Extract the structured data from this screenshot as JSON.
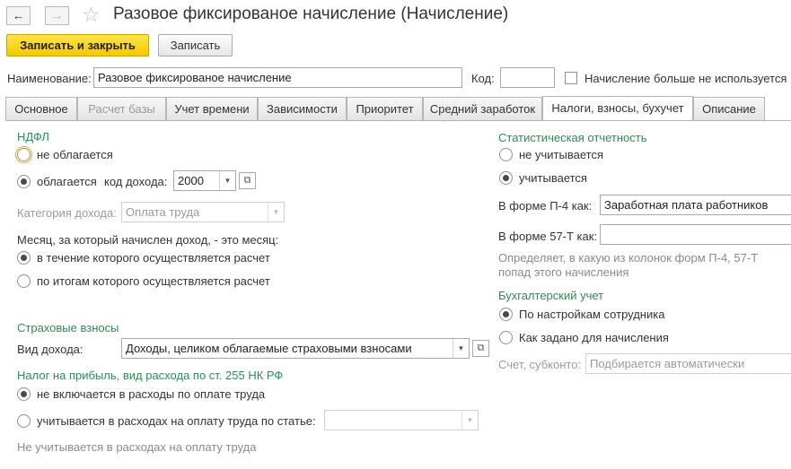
{
  "window": {
    "title": "Разовое фиксированое начисление (Начисление)"
  },
  "toolbar": {
    "save_close_label": "Записать и закрыть",
    "save_label": "Записать"
  },
  "header": {
    "name_label": "Наименование:",
    "name_value": "Разовое фиксированое начисление",
    "code_label": "Код:",
    "code_value": "",
    "unused_label": "Начисление больше не используется"
  },
  "tabs": [
    {
      "label": "Основное"
    },
    {
      "label": "Расчет базы"
    },
    {
      "label": "Учет времени"
    },
    {
      "label": "Зависимости"
    },
    {
      "label": "Приоритет"
    },
    {
      "label": "Средний заработок"
    },
    {
      "label": "Налоги, взносы, бухучет"
    },
    {
      "label": "Описание"
    }
  ],
  "ndfl": {
    "title": "НДФЛ",
    "not_taxed": "не облагается",
    "taxed": "облагается",
    "income_code_label": "код дохода:",
    "income_code_value": "2000",
    "category_label": "Категория дохода:",
    "category_value": "Оплата труда",
    "month_question": "Месяц, за который начислен доход, - это месяц:",
    "month_during": "в течение которого осуществляется расчет",
    "month_results": "по итогам которого осуществляется расчет"
  },
  "insurance": {
    "title": "Страховые взносы",
    "income_type_label": "Вид дохода:",
    "income_type_value": "Доходы, целиком облагаемые страховыми взносами"
  },
  "profit_tax": {
    "title": "Налог на прибыль, вид расхода по ст. 255 НК РФ",
    "not_included": "не включается в расходы по оплате труда",
    "included_by_article": "учитывается в расходах на оплату труда по статье:",
    "article_value": "",
    "note": "Не учитывается в расходах на оплату труда"
  },
  "stats": {
    "title": "Статистическая отчетность",
    "not_counted": "не учитывается",
    "counted": "учитывается",
    "p4_label": "В форме П-4 как:",
    "p4_value": "Заработная плата работников",
    "t57_label": "В форме 57-Т как:",
    "t57_value": "",
    "hint": "Определяет, в какую из колонок форм П-4, 57-Т попад этого начисления"
  },
  "accounting": {
    "title": "Бухгалтерский учет",
    "by_employee": "По настройкам сотрудника",
    "as_accrual": "Как задано для начисления",
    "account_label": "Счет, субконто:",
    "account_placeholder": "Подбирается автоматически"
  },
  "colors": {
    "accent_green": "#2e8b57",
    "primary_button": "#f5c800"
  }
}
